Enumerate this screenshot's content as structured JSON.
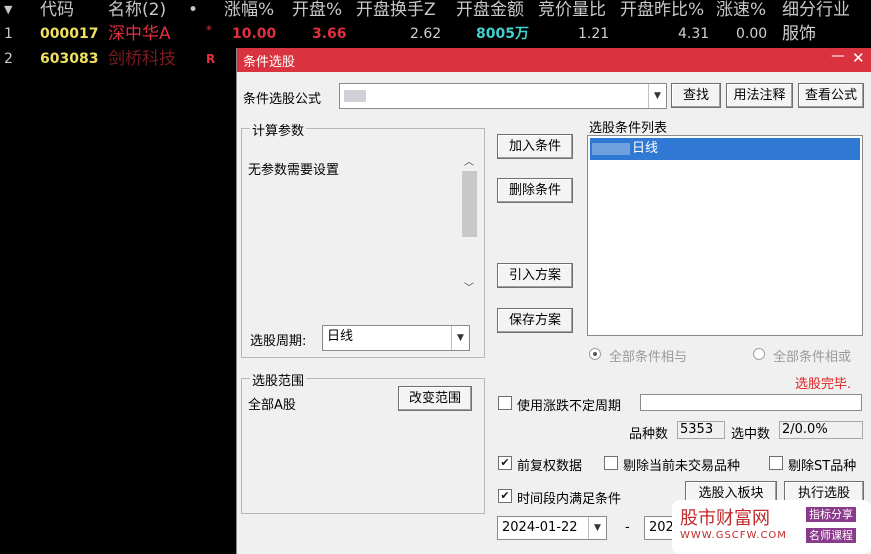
{
  "table": {
    "headers": [
      "代码",
      "名称(2)",
      "•",
      "涨幅%",
      "开盘%",
      "开盘换手Z",
      "开盘金额",
      "竞价量比",
      "开盘昨比%",
      "涨速%",
      "细分行业"
    ],
    "rows": [
      {
        "idx": "1",
        "code": "000017",
        "name": "深中华A",
        "flag": "*",
        "change": "10.00",
        "open_pct": "3.66",
        "open_turnover": "2.62",
        "open_amount": "8005万",
        "auction_ratio": "1.21",
        "open_prev_ratio": "4.31",
        "speed": "0.00",
        "industry": "服饰"
      },
      {
        "idx": "2",
        "code": "603083",
        "name": "剑桥科技",
        "flag": "R"
      }
    ]
  },
  "dialog": {
    "title": "条件选股",
    "formula_label": "条件选股公式",
    "formula_value": "",
    "find_button": "查找",
    "usage_button": "用法注释",
    "view_formula_button": "查看公式",
    "params_group": "计算参数",
    "params_text": "无参数需要设置",
    "period_label": "选股周期:",
    "period_value": "日线",
    "add_button": "加入条件",
    "delete_button": "删除条件",
    "import_button": "引入方案",
    "save_button": "保存方案",
    "condition_list_label": "选股条件列表",
    "conditions": [
      "日线"
    ],
    "radio_and": "全部条件相与",
    "radio_or": "全部条件相或",
    "status": "选股完毕.",
    "scope_group": "选股范围",
    "scope_value": "全部A股",
    "change_scope_button": "改变范围",
    "use_period_label": "使用涨跌不定周期",
    "count_label": "品种数",
    "count_value": "5353",
    "selected_label": "选中数",
    "selected_value": "2/0.0%",
    "pre_adjust_label": "前复权数据",
    "exclude_untraded_label": "剔除当前未交易品种",
    "exclude_st_label": "剔除ST品种",
    "time_range_label": "时间段内满足条件",
    "start_date": "2024-01-22",
    "dash": "-",
    "end_date": "202",
    "to_block_button": "选股入板块",
    "execute_button": "执行选股"
  },
  "watermark": {
    "title": "股市财富网",
    "url": "WWW.GSCFW.COM",
    "tag1": "指标分享",
    "tag2": "名师课程"
  },
  "colors": {
    "accent": "#d9333f",
    "code_yellow": "#f0e060",
    "name_red": "#e03040",
    "selection_blue": "#2f78d4",
    "status_red": "#e02020"
  }
}
